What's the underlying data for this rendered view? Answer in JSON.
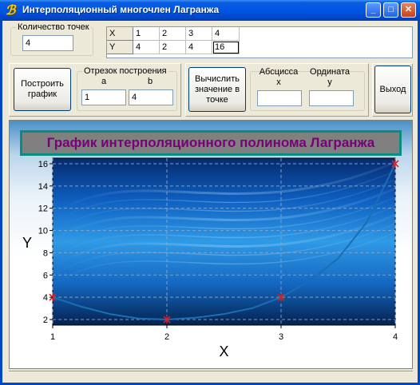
{
  "window": {
    "title": "Интерполяционный многочлен Лагранжа",
    "icon": "borland-app-icon"
  },
  "titlebar_buttons": {
    "minimize": "_",
    "maximize": "□",
    "close": "✕"
  },
  "points_group": {
    "legend": "Количество точек",
    "value": "4"
  },
  "table": {
    "rows": [
      {
        "header": "X",
        "values": [
          "1",
          "2",
          "3",
          "4"
        ]
      },
      {
        "header": "Y",
        "values": [
          "4",
          "2",
          "4",
          "16"
        ]
      }
    ]
  },
  "build_button": {
    "label_line1": "Построить",
    "label_line2": "график"
  },
  "segment_group": {
    "legend": "Отрезок построения",
    "a_label": "a",
    "b_label": "b",
    "a_value": "1",
    "b_value": "4"
  },
  "calc_button": {
    "label_line1": "Вычислить",
    "label_line2": "значение в",
    "label_line3": "точке"
  },
  "abscissa": {
    "label_line1": "Абсцисса",
    "label_line2": "x",
    "value": ""
  },
  "ordinate": {
    "label_line1": "Ордината",
    "label_line2": "y",
    "value": ""
  },
  "exit_button": {
    "label": "Выход"
  },
  "chart_title": "График интерполяционного полинома Лагранжа",
  "chart_data": {
    "type": "line",
    "title": "График интерполяционного полинома Лагранжа",
    "xlabel": "X",
    "ylabel": "Y",
    "xlim": [
      1,
      4
    ],
    "ylim": [
      1.5,
      16.5
    ],
    "x_ticks": [
      1,
      2,
      3,
      4
    ],
    "y_ticks": [
      2,
      4,
      6,
      8,
      10,
      12,
      14,
      16
    ],
    "grid": true,
    "nodes": {
      "x": [
        1,
        2,
        3,
        4
      ],
      "y": [
        4,
        2,
        4,
        16
      ]
    },
    "series": [
      {
        "x": [
          1.0,
          1.25,
          1.5,
          1.75,
          2.0,
          2.25,
          2.5,
          2.75,
          3.0,
          3.25,
          3.5,
          3.75,
          4.0
        ],
        "y": [
          4.0,
          3.16,
          2.5,
          2.09,
          2.0,
          2.16,
          2.5,
          3.03,
          4.0,
          5.47,
          7.5,
          10.72,
          16.0
        ]
      }
    ],
    "colors": {
      "line": "#1a6fb4",
      "marker": "#e0201e",
      "axis": "#000000",
      "grid": "#8aa8c8"
    }
  }
}
